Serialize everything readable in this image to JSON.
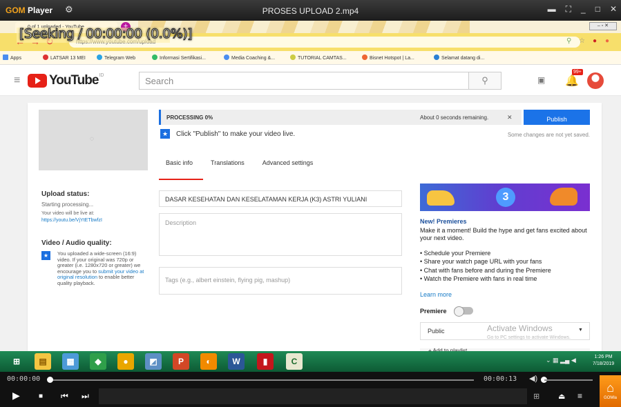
{
  "player": {
    "brand_a": "GOM",
    "brand_b": "Player",
    "file_title": "PROSES UPLOAD 2.mp4",
    "osd_text": "[Seeking / 00:00:00 (0.0%)]",
    "current_time": "00:00:00",
    "total_time": "00:00:13",
    "home_label": "GOMla",
    "progress_fraction": 0.0
  },
  "browser": {
    "tab_title": "0 of 1 uploaded - YouTube",
    "url": "https://www.youtube.com/upload",
    "bookmarks": [
      "Apps",
      "LATSAR 13 MEI",
      "Telegram Web",
      "Informasi Sertifikasi...",
      "Media Coaching &...",
      "TUTORIAL CAMTAS...",
      "Bisnet Hotspot | La...",
      "Selamat datang di..."
    ]
  },
  "youtube": {
    "logo_text": "YouTube",
    "logo_sup": "ID",
    "search_placeholder": "Search",
    "notif_count": "99+",
    "processing_label": "PROCESSING 0%",
    "processing_fraction": 0.0,
    "remaining": "About 0 seconds remaining.",
    "publish_label": "Publish",
    "hint": "Click \"Publish\" to make your video live.",
    "saved_note": "Some changes are not yet saved.",
    "tabs": [
      "Basic info",
      "Translations",
      "Advanced settings"
    ],
    "upload_status_h": "Upload status:",
    "upload_status": "Starting processing...",
    "live_at": "Your video will be live at:",
    "live_link": "https://youtu.be/VjYtETbwfzI",
    "vq_h": "Video / Audio quality:",
    "vq_text_a": "You uploaded a wide-screen (16:9) video. If your original was 720p or greater (i.e. 1280x720 or greater) we encourage you to ",
    "vq_link": "submit your video at original resolution",
    "vq_text_b": " to enable better quality playback.",
    "title_value": "DASAR KESEHATAN DAN KESELATAMAN KERJA (K3) ASTRI YULIANI",
    "desc_placeholder": "Description",
    "tags_placeholder": "Tags (e.g., albert einstein, flying pig, mashup)",
    "banner_num": "3",
    "np_h": "New! Premieres",
    "np_t": "Make it a moment! Build the hype and get fans excited about your next video.",
    "np_items": [
      "• Schedule your Premiere",
      "• Share your watch page URL with your fans",
      "• Chat with fans before and during the Premiere",
      "• Watch the Premiere with fans in real time"
    ],
    "learn_more": "Learn more",
    "premiere_label": "Premiere",
    "privacy": "Public",
    "activate_a": "Activate Windows",
    "activate_b": "Go to PC settings to activate Windows.",
    "add_playlist": "+ Add to playlist"
  },
  "taskbar": {
    "clock_time": "1:26 PM",
    "clock_date": "7/18/2019"
  },
  "colors": {
    "accent": "#1b73e8",
    "yt_red": "#e62117",
    "taskbar": "#0d5a34",
    "gom_orange": "#f2a21c"
  }
}
